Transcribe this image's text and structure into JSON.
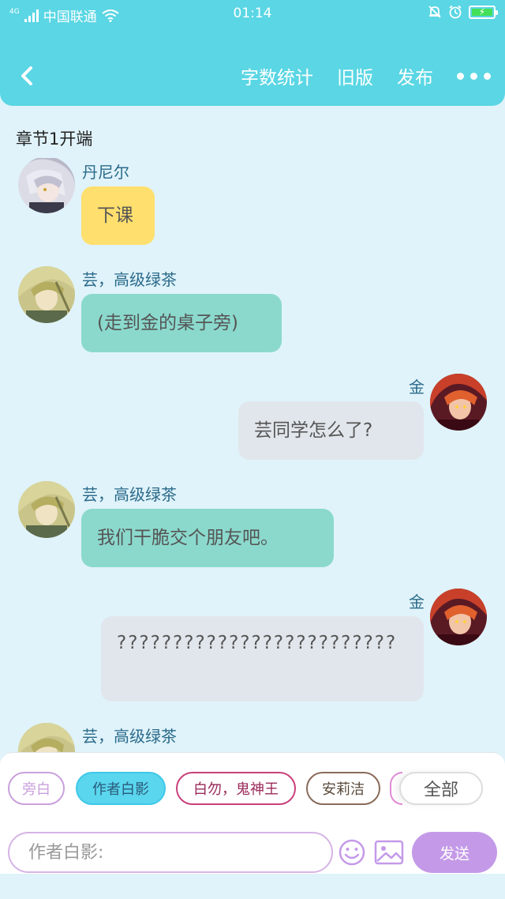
{
  "status_bar": {
    "network_tag": "4G",
    "carrier": "中国联通",
    "time": "01:14"
  },
  "nav": {
    "actions": [
      "字数统计",
      "旧版",
      "发布"
    ]
  },
  "chapter": {
    "title": "章节1开端"
  },
  "messages": [
    {
      "side": "left",
      "name": "丹尼尔",
      "text": "下课",
      "bubble": "yellow",
      "avatar": "silver-hair-character-avatar"
    },
    {
      "side": "left",
      "name": "芸，高级绿茶",
      "text": "(走到金的桌子旁)",
      "bubble": "teal",
      "avatar": "blonde-character-avatar"
    },
    {
      "side": "right",
      "name": "金",
      "text": "芸同学怎么了?",
      "bubble": "gray",
      "avatar": "red-hair-character-avatar"
    },
    {
      "side": "left",
      "name": "芸，高级绿茶",
      "text": "我们干脆交个朋友吧。",
      "bubble": "teal",
      "avatar": "blonde-character-avatar"
    },
    {
      "side": "right",
      "name": "金",
      "text": "?????????????????????????",
      "bubble": "gray",
      "avatar": "red-hair-character-avatar"
    },
    {
      "side": "left",
      "name": "芸，高级绿茶",
      "text": "",
      "bubble": "teal",
      "avatar": "blonde-character-avatar"
    }
  ],
  "role_tags": [
    {
      "label": "旁白",
      "border": "#c9a0dc",
      "color": "#c9a0dc",
      "bg": "#ffffff"
    },
    {
      "label": "作者白影",
      "border": "#3fc8e8",
      "color": "#2a5a7a",
      "bg": "#5ad6ee"
    },
    {
      "label": "白勿，鬼神王",
      "border": "#c9407a",
      "color": "#9a2a5a",
      "bg": "#ffffff"
    },
    {
      "label": "安莉洁",
      "border": "#8a6a5a",
      "color": "#5a4a3a",
      "bg": "#ffffff"
    }
  ],
  "all_tag": "全部",
  "input": {
    "placeholder": "作者白影:",
    "value": ""
  },
  "send_label": "发送",
  "colors": {
    "header": "#5ad6e4",
    "background": "#e0f3fa",
    "send": "#c49ae8"
  }
}
